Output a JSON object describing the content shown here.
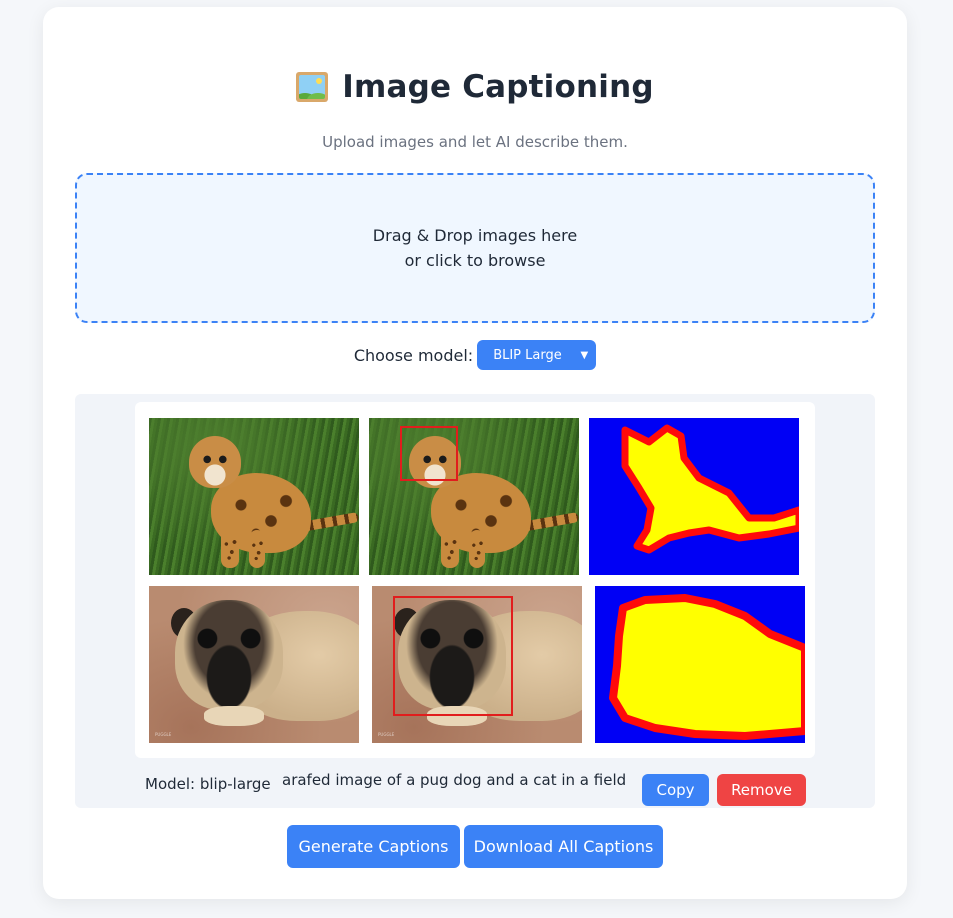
{
  "header": {
    "title": "Image Captioning",
    "title_icon": "framed-picture-icon",
    "subtitle": "Upload images and let AI describe them."
  },
  "dropzone": {
    "line1": "Drag & Drop images here",
    "line2": "or click to browse"
  },
  "model_select": {
    "label": "Choose model:",
    "selected": "BLIP Large",
    "chevron_icon": "chevron-down-icon"
  },
  "result": {
    "model_label": "Model: blip-large",
    "caption": "arafed image of a pug dog and a cat in a field",
    "copy_label": "Copy",
    "remove_label": "Remove",
    "watermark_text": "PUGGLE"
  },
  "actions": {
    "generate_label": "Generate Captions",
    "download_label": "Download All Captions"
  },
  "colors": {
    "primary": "#3b82f6",
    "danger": "#ef4444",
    "segmentation_background": "#0000f5",
    "segmentation_fill": "#ffff00",
    "segmentation_outline": "#ff0a0a"
  }
}
